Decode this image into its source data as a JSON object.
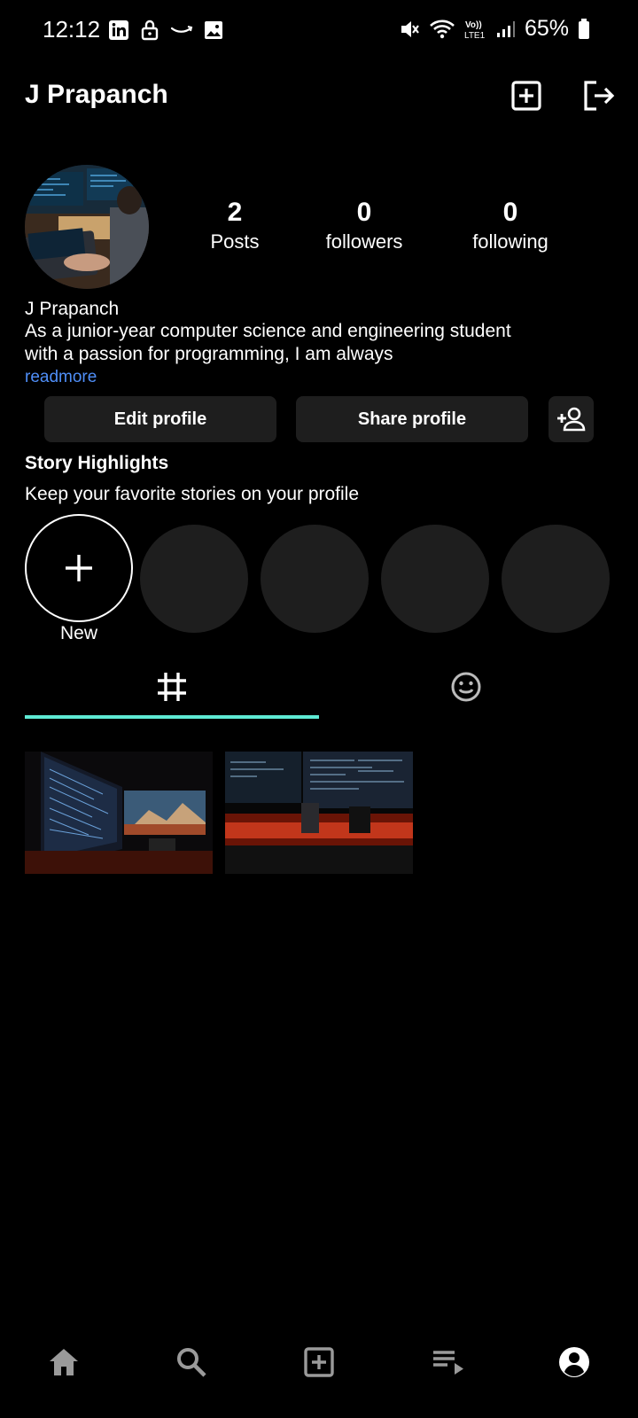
{
  "status_bar": {
    "time": "12:12",
    "battery": "65%",
    "left_icons": [
      "linkedin-icon",
      "lock-icon",
      "amazon-icon",
      "image-icon"
    ],
    "right_icons": [
      "mute-icon",
      "wifi-icon",
      "volte-icon",
      "signal-icon",
      "battery-icon"
    ]
  },
  "header": {
    "title": "J Prapanch",
    "actions": [
      "add-post-icon",
      "logout-icon"
    ]
  },
  "profile": {
    "name": "J Prapanch",
    "bio": "As a junior-year computer science and engineering student with a passion for programming, I am always",
    "readmore": "readmore",
    "stats": [
      {
        "count": "2",
        "label": "Posts"
      },
      {
        "count": "0",
        "label": "followers"
      },
      {
        "count": "0",
        "label": "following"
      }
    ]
  },
  "buttons": {
    "edit": "Edit profile",
    "share": "Share profile"
  },
  "highlights": {
    "title": "Story Highlights",
    "subtitle": "Keep your favorite stories on your profile",
    "new_label": "New"
  },
  "tabs": [
    "grid-icon",
    "tagged-emoji-icon"
  ],
  "posts_count": 2,
  "colors": {
    "background": "#000000",
    "button": "#1e1e1e",
    "accent": "#5eead4",
    "link": "#4f8ef7"
  },
  "bottom_nav": [
    "home-icon",
    "search-icon",
    "add-icon",
    "playlist-icon",
    "profile-icon"
  ]
}
